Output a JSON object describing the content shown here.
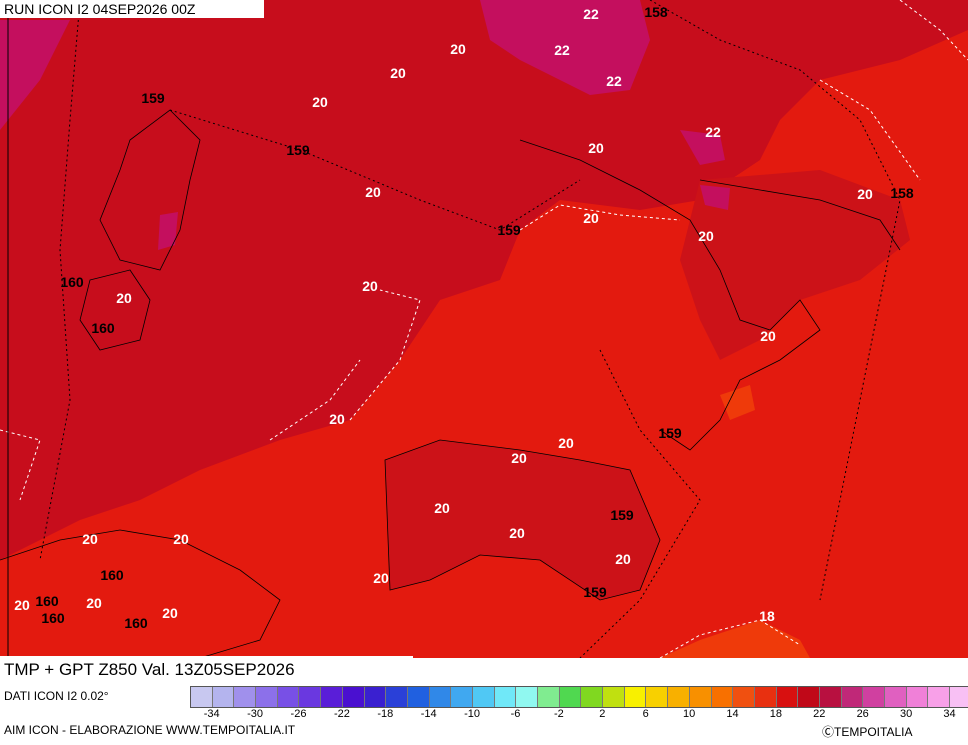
{
  "header": {
    "run_title": "RUN ICON I2 04SEP2026 00Z"
  },
  "map": {
    "title": "TMP + GPT Z850 Val. 13Z05SEP2026",
    "temp_labels": [
      "20",
      "20",
      "20",
      "20",
      "20",
      "20",
      "20",
      "20",
      "20",
      "20",
      "20",
      "20",
      "20",
      "20",
      "20",
      "20",
      "20",
      "20",
      "20",
      "20",
      "20",
      "20",
      "22",
      "22",
      "22",
      "22",
      "18"
    ],
    "gpt_labels": [
      "159",
      "159",
      "159",
      "159",
      "159",
      "159",
      "160",
      "160",
      "160",
      "160",
      "160",
      "160",
      "158",
      "158"
    ],
    "colors": {
      "base": "#d81a14",
      "dark": "#c30d1c",
      "warm": "#e6200f",
      "magenta": "#c80f60",
      "orange": "#ef3a0a"
    }
  },
  "footer": {
    "data_source": "DATI ICON I2 0.02°",
    "credit": "AIM ICON - ELABORAZIONE WWW.TEMPOITALIA.IT",
    "copyright": "ⒸTEMPOITALIA"
  },
  "scale": {
    "colors": [
      "#c8c8f0",
      "#b4b4ee",
      "#a090ec",
      "#8c70ea",
      "#7850e6",
      "#6a38e0",
      "#5a1ed8",
      "#4a10d0",
      "#3a20d0",
      "#2a40d8",
      "#2060e0",
      "#3088e8",
      "#40a8f0",
      "#50c8f4",
      "#70e8f8",
      "#90f8f0",
      "#80ec90",
      "#50d850",
      "#80d820",
      "#c0e010",
      "#f8f000",
      "#f8d000",
      "#f8b000",
      "#f89000",
      "#f87000",
      "#f05010",
      "#e83010",
      "#d81010",
      "#c00818",
      "#b81040",
      "#c02878",
      "#d040a0",
      "#e060c0",
      "#f080d8",
      "#f8a0e8",
      "#f8c0f4"
    ],
    "ticks": [
      "-34",
      "-30",
      "-26",
      "-22",
      "-18",
      "-14",
      "-10",
      "-6",
      "-2",
      "2",
      "6",
      "10",
      "14",
      "18",
      "22",
      "26",
      "30",
      "34"
    ]
  }
}
